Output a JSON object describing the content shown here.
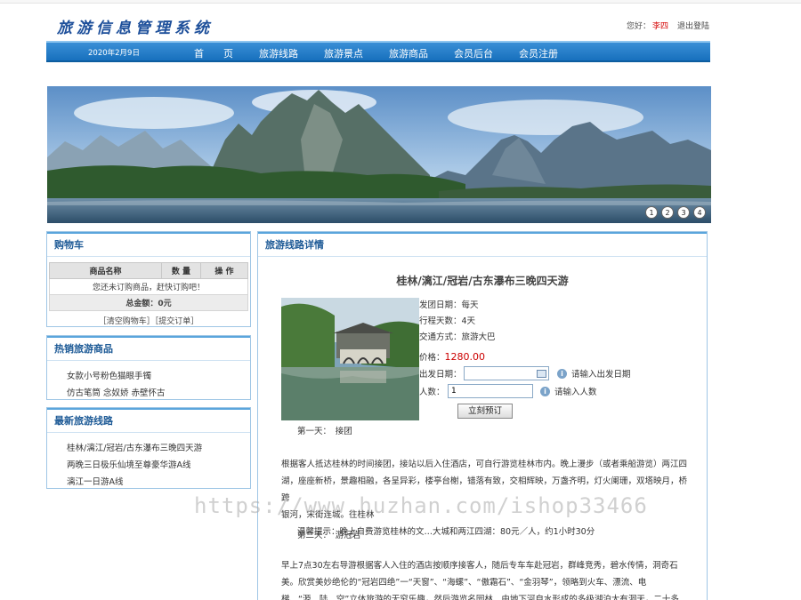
{
  "site": {
    "logo": "旅游信息管理系统",
    "greeting": "您好：",
    "username": "李四",
    "logout": "退出登陆"
  },
  "nav": {
    "date": "2020年2月9日",
    "items": [
      "首　　页",
      "旅游线路",
      "旅游景点",
      "旅游商品",
      "会员后台",
      "会员注册"
    ]
  },
  "banner": {
    "dots": [
      "1",
      "2",
      "3",
      "4"
    ]
  },
  "cart": {
    "title": "购物车",
    "headers": [
      "商品名称",
      "数 量",
      "操 作"
    ],
    "empty": "您还未订购商品，赶快订购吧！",
    "total": "总金额：0元",
    "actions": "［清空购物车］［提交订单］"
  },
  "hot": {
    "title": "热销旅游商品",
    "items": [
      "女款小号粉色猫眼手镯",
      "仿古笔筒 念奴娇 赤壁怀古"
    ]
  },
  "latest": {
    "title": "最新旅游线路",
    "items": [
      "桂林/漓江/冠岩/古东瀑布三晚四天游",
      "两晚三日极乐仙境至尊豪华游A线",
      "漓江一日游A线"
    ]
  },
  "detail": {
    "panel_title": "旅游线路详情",
    "route_title": "桂林/漓江/冠岩/古东瀑布三晚四天游",
    "departure": "发团日期：每天",
    "days": "行程天数：4天",
    "transport": "交通方式：旅游大巴",
    "price_label": "价格：",
    "price": "1280.00",
    "date_label": "出发日期：",
    "date_value": "",
    "date_tip": "请输入出发日期",
    "people_label": "人数：",
    "people_value": "1",
    "people_tip": "请输入人数",
    "book_button": "立刻预订",
    "day1": "第一天：　接团",
    "para1_line1": "根据客人抵达桂林的时间接团，接站以后入住酒店，可自行游览桂林市内。晚上漫步（或者乘船游览）两江四",
    "para1_line2": "湖，座座新桥，景趣相融，各呈异彩，楼亭台榭，错落有致，交相辉映，万盏齐明，灯火阑珊，双塔映月，桥跨",
    "para1_line3": "银河，宋街连城。往桂林",
    "para1_line4": "温馨提示：晚上自费游览桂林的文…大城和两江四湖：80元／人，约1小时30分",
    "day2": "第二天：　游冠岩",
    "para2_line1": "早上7点30左右导游根据客人入住的酒店按顺序接客人，随后专车车赴冠岩，群峰竞秀，碧水传情，洞奇石",
    "para2_line2": "美。欣赏美妙绝伦的“冠岩四绝”一“天窗”、“海螺”、“傲霜石”、“金羽琴”，领略到火车、漂流、电",
    "para2_line3": "梯、“源、陆、空”立体旅游的无穷乐趣，然后游览名园林、由地下河自水形成的多级湖泊大有洞天，二十多奇"
  },
  "watermark": "https://www.huzhan.com/ishop33466"
}
